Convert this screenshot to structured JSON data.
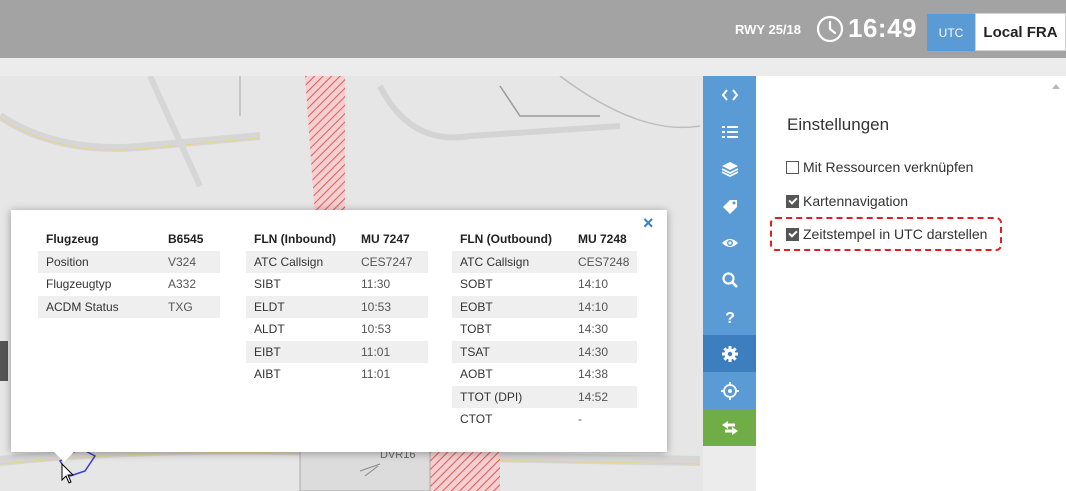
{
  "header": {
    "runway": "RWY 25/18",
    "time": "16:49",
    "utc_label": "UTC",
    "local_label": "Local FRA"
  },
  "map": {
    "label": "DVR16"
  },
  "toolbar": {
    "buttons": [
      {
        "icon": "code-icon"
      },
      {
        "icon": "list-icon"
      },
      {
        "icon": "layers-icon"
      },
      {
        "icon": "tag-icon"
      },
      {
        "icon": "eye-icon"
      },
      {
        "icon": "search-icon"
      },
      {
        "icon": "help-icon"
      },
      {
        "icon": "gear-icon"
      },
      {
        "icon": "crosshair-icon"
      },
      {
        "icon": "swap-icon"
      }
    ],
    "active": "gear-icon"
  },
  "settings": {
    "title": "Einstellungen",
    "options": [
      {
        "label": "Mit Ressourcen verknüpfen",
        "checked": false
      },
      {
        "label": "Kartennavigation",
        "checked": true
      },
      {
        "label": "Zeitstempel in UTC darstellen",
        "checked": true
      }
    ]
  },
  "popup": {
    "close": "×",
    "aircraft": {
      "header": [
        "Flugzeug",
        "B6545"
      ],
      "rows": [
        [
          "Position",
          "V324"
        ],
        [
          "Flugzeugtyp",
          "A332"
        ],
        [
          "ACDM Status",
          "TXG"
        ]
      ]
    },
    "inbound": {
      "header": [
        "FLN (Inbound)",
        "MU 7247"
      ],
      "rows": [
        [
          "ATC Callsign",
          "CES7247"
        ],
        [
          "SIBT",
          "11:30"
        ],
        [
          "ELDT",
          "10:53"
        ],
        [
          "ALDT",
          "10:53"
        ],
        [
          "EIBT",
          "11:01"
        ],
        [
          "AIBT",
          "11:01"
        ]
      ]
    },
    "outbound": {
      "header": [
        "FLN (Outbound)",
        "MU 7248"
      ],
      "rows": [
        [
          "ATC Callsign",
          "CES7248"
        ],
        [
          "SOBT",
          "14:10"
        ],
        [
          "EOBT",
          "14:10"
        ],
        [
          "TOBT",
          "14:30"
        ],
        [
          "TSAT",
          "14:30"
        ],
        [
          "AOBT",
          "14:38"
        ],
        [
          "TTOT (DPI)",
          "14:52"
        ],
        [
          "CTOT",
          "-"
        ]
      ]
    }
  },
  "colors": {
    "header_bg": "#a3a3a3",
    "toolbar_blue": "#5b9bd5",
    "toolbar_green": "#70ad47",
    "highlight_red": "#e02020",
    "close_blue": "#3b7fc4"
  }
}
